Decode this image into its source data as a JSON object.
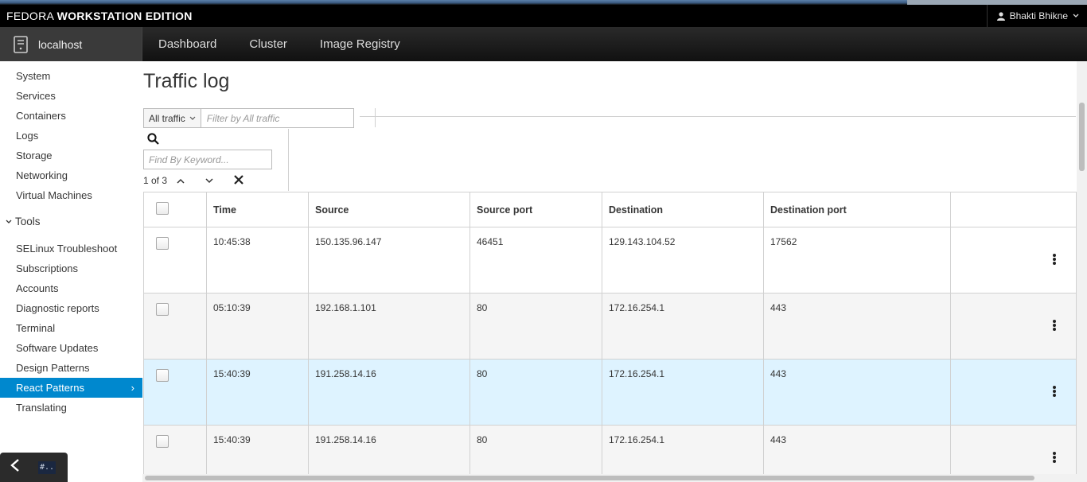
{
  "brand": {
    "prefix": "FEDORA",
    "bold": "WORKSTATION EDITION"
  },
  "user": {
    "name": "Bhakti Bhikne"
  },
  "host": {
    "name": "localhost"
  },
  "nav": [
    "Dashboard",
    "Cluster",
    "Image Registry"
  ],
  "sidebar": {
    "top_items": [
      "System",
      "Services",
      "Containers",
      "Logs",
      "Storage",
      "Networking",
      "Virtual Machines"
    ],
    "group": "Tools",
    "tool_items": [
      "SELinux Troubleshoot",
      "Subscriptions",
      "Accounts",
      "Diagnostic reports",
      "Terminal",
      "Software Updates",
      "Design Patterns",
      "React Patterns",
      "Translating"
    ],
    "active": "React Patterns"
  },
  "page": {
    "title": "Traffic log"
  },
  "filter": {
    "dropdown": "All traffic",
    "placeholder": "Filter by All traffic"
  },
  "find": {
    "placeholder": "Find By Keyword...",
    "counter": "1 of 3"
  },
  "table": {
    "columns": [
      "Time",
      "Source",
      "Source port",
      "Destination",
      "Destination port"
    ],
    "rows": [
      {
        "time": "10:45:38",
        "source": "150.135.96.147",
        "source_port": "46451",
        "destination": "129.143.104.52",
        "destination_port": "17562"
      },
      {
        "time": "05:10:39",
        "source": "192.168.1.101",
        "source_port": "80",
        "destination": "172.16.254.1",
        "destination_port": "443"
      },
      {
        "time": "15:40:39",
        "source": "191.258.14.16",
        "source_port": "80",
        "destination": "172.16.254.1",
        "destination_port": "443"
      },
      {
        "time": "15:40:39",
        "source": "191.258.14.16",
        "source_port": "80",
        "destination": "172.16.254.1",
        "destination_port": "443"
      }
    ],
    "highlighted_row": 2
  },
  "colors": {
    "accent": "#0088ce",
    "highlight": "#def3ff"
  }
}
